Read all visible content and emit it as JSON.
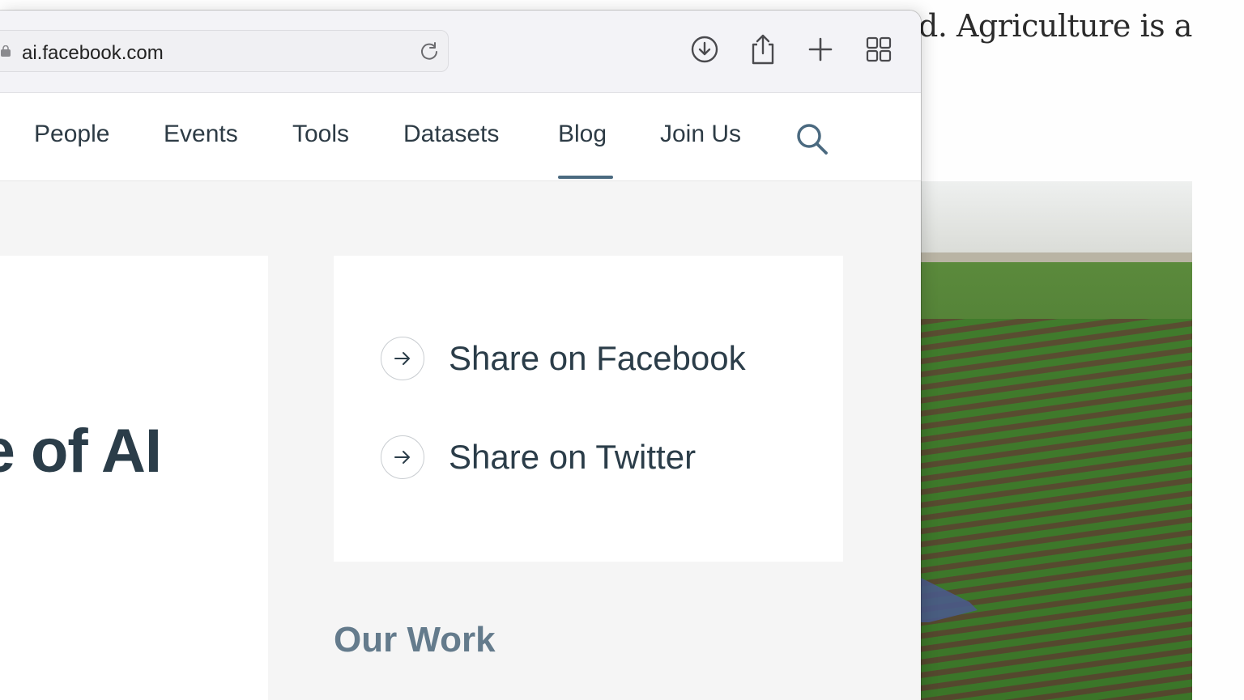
{
  "background_page": {
    "text_fragment": "d. Agriculture is a"
  },
  "browser": {
    "url": "ai.facebook.com",
    "toolbar_icons": [
      "download-icon",
      "share-icon",
      "new-tab-icon",
      "tab-overview-icon"
    ]
  },
  "nav": {
    "items": [
      {
        "label": "People"
      },
      {
        "label": "Events"
      },
      {
        "label": "Tools"
      },
      {
        "label": "Datasets"
      },
      {
        "label": "Blog",
        "active": true
      },
      {
        "label": "Join Us"
      }
    ],
    "search_icon": "search-icon"
  },
  "hero": {
    "title_fragment": "e of AI"
  },
  "share": {
    "facebook_label": "Share on Facebook",
    "twitter_label": "Share on Twitter"
  },
  "section": {
    "our_work": "Our Work"
  },
  "colors": {
    "nav_text": "#2d3b45",
    "accent_underline": "#4b6a80",
    "heading_muted": "#647b8c",
    "share_text": "#2b3d49"
  }
}
